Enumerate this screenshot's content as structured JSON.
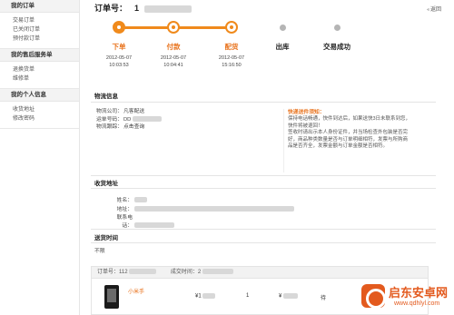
{
  "sidebar": {
    "groups": [
      {
        "title": "我的订单",
        "items": [
          "交易订单",
          "已关闭订单",
          "预付款订单"
        ]
      },
      {
        "title": "我的售后服务单",
        "items": [
          "退换货单",
          "维修单"
        ]
      },
      {
        "title": "我的个人信息",
        "items": [
          "收货地址",
          "修改密码"
        ]
      }
    ]
  },
  "order": {
    "label": "订单号：",
    "number_visible": "1",
    "back_link": "返回"
  },
  "progress": {
    "steps": [
      {
        "label": "下单",
        "date": "2012-05-07",
        "time": "10:03:53",
        "state": "done"
      },
      {
        "label": "付款",
        "date": "2012-05-07",
        "time": "10:04:41",
        "state": "done"
      },
      {
        "label": "配货",
        "date": "2012-05-07",
        "time": "15:16:50",
        "state": "done"
      },
      {
        "label": "出库",
        "date": "",
        "time": "",
        "state": "pending"
      },
      {
        "label": "交易成功",
        "date": "",
        "time": "",
        "state": "pending"
      }
    ],
    "colors": {
      "active": "#f08a1c",
      "pending": "#b5b5b5"
    }
  },
  "logistics": {
    "title": "物流信息",
    "company_label": "物流公司：",
    "company_value": "凡客配送",
    "waybill_label": "运单号码：",
    "waybill_value": "DD",
    "tracking_label": "物流跟踪：",
    "tracking_value": "点击查询",
    "tips_title": "快递送件须知：",
    "tips_lines": [
      "保持电话畅通，快件到达后，如果送快3日未联系到您，",
      "快件将被退回！",
      "签收时请出示本人身份证件，并当场检查外包装是否完",
      "好，商品种类数量是否与订单明细相符，发票与所购商",
      "品是否齐全，发票金额与订单金额是否相符。"
    ]
  },
  "shipping": {
    "title": "收货地址",
    "name_label": "姓名：",
    "address_label": "地址：",
    "phone_label": "联系电话："
  },
  "delivery_time": {
    "title": "送货时间",
    "value": "不限"
  },
  "items_table": {
    "order_no_label": "订单号：112",
    "time_label": "成交时间：2",
    "row": {
      "product_name": "小米手",
      "price_prefix": "¥1",
      "quantity": "1",
      "subtotal_prefix": "¥",
      "status": "待"
    }
  },
  "watermark": {
    "text": "启东安卓网",
    "url": "www.qdhlyl.com"
  }
}
